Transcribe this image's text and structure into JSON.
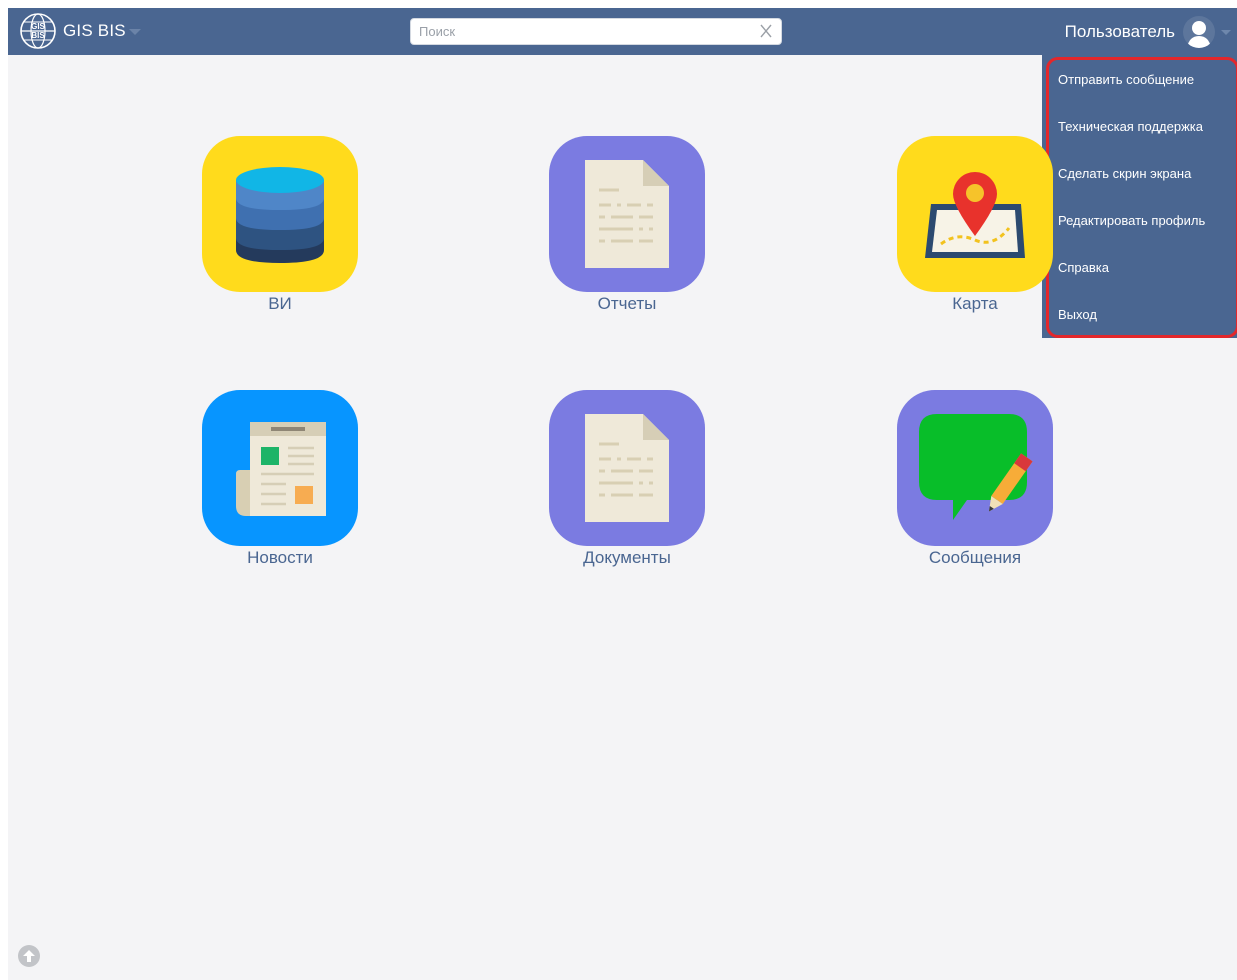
{
  "header": {
    "brand_name": "GIS BIS",
    "search_placeholder": "Поиск",
    "user_name": "Пользователь"
  },
  "user_menu": {
    "items": [
      {
        "label": "Отправить сообщение"
      },
      {
        "label": "Техническая поддержка"
      },
      {
        "label": "Сделать скрин экрана"
      },
      {
        "label": "Редактировать профиль"
      },
      {
        "label": "Справка"
      },
      {
        "label": "Выход"
      }
    ]
  },
  "apps": [
    {
      "label": "ВИ",
      "icon": "database-icon",
      "color": "#ffdb1c"
    },
    {
      "label": "Отчеты",
      "icon": "document-icon",
      "color": "#7b7be1"
    },
    {
      "label": "Карта",
      "icon": "map-pin-icon",
      "color": "#ffdb1c"
    },
    {
      "label": "Новости",
      "icon": "newspaper-icon",
      "color": "#0795ff"
    },
    {
      "label": "Документы",
      "icon": "document-icon",
      "color": "#7b7be1"
    },
    {
      "label": "Сообщения",
      "icon": "chat-bubble-icon",
      "color": "#7b7be1"
    }
  ],
  "colors": {
    "header_bg": "#4a6691",
    "page_bg": "#f4f4f6",
    "label_text": "#4a6691",
    "menu_highlight": "#e3272b"
  },
  "misc": {
    "scroll_icon": "scroll-up-icon"
  }
}
